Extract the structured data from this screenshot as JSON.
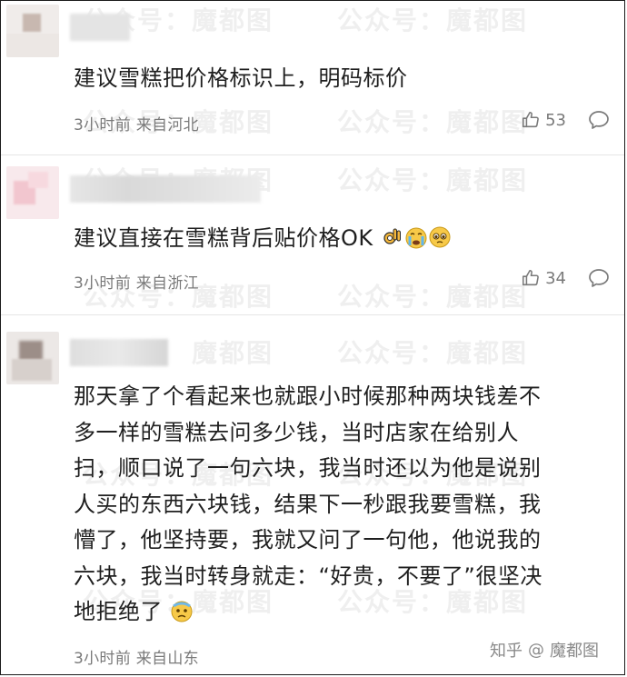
{
  "watermark": {
    "texts": [
      "公众号：魔都图",
      "公众号：魔都图",
      "魔都图",
      "公众号：魔都图"
    ]
  },
  "comments": [
    {
      "text_lines": [
        "建议雪糕把价格标识上，明码标价"
      ],
      "time": "3小时前",
      "location": "来自河北",
      "likes": "53"
    },
    {
      "text_lines": [
        "建议直接在雪糕背后贴价格OK"
      ],
      "time": "3小时前",
      "location": "来自浙江",
      "likes": "34"
    },
    {
      "text_lines": [
        "那天拿了个看起来也就跟小时候那种两块钱差不",
        "多一样的雪糕去问多少钱，当时店家在给别人",
        "扫，顺口说了一句六块，我当时还以为他是说别",
        "人买的东西六块钱，结果下一秒跟我要雪糕，我",
        "懵了，他坚持要，我就又问了一句他，他说我的",
        "六块，我当时转身就走：“好贵，不要了”很坚决",
        "地拒绝了"
      ],
      "time": "3小时前",
      "location": "来自山东"
    }
  ],
  "footer": {
    "brand": "知乎",
    "sep": "@",
    "author": "魔都图"
  },
  "icons": {
    "like": "thumbs-up-icon",
    "reply": "comment-bubble-icon",
    "emoji_ok": "ok-hand-emoji",
    "emoji_cry": "crying-face-emoji",
    "emoji_plead": "pleading-face-emoji",
    "emoji_anxious": "anxious-sweat-face-emoji"
  },
  "colors": {
    "text": "#1f1f1f",
    "meta": "#7a7a7a",
    "divider": "#e6e6e6"
  }
}
